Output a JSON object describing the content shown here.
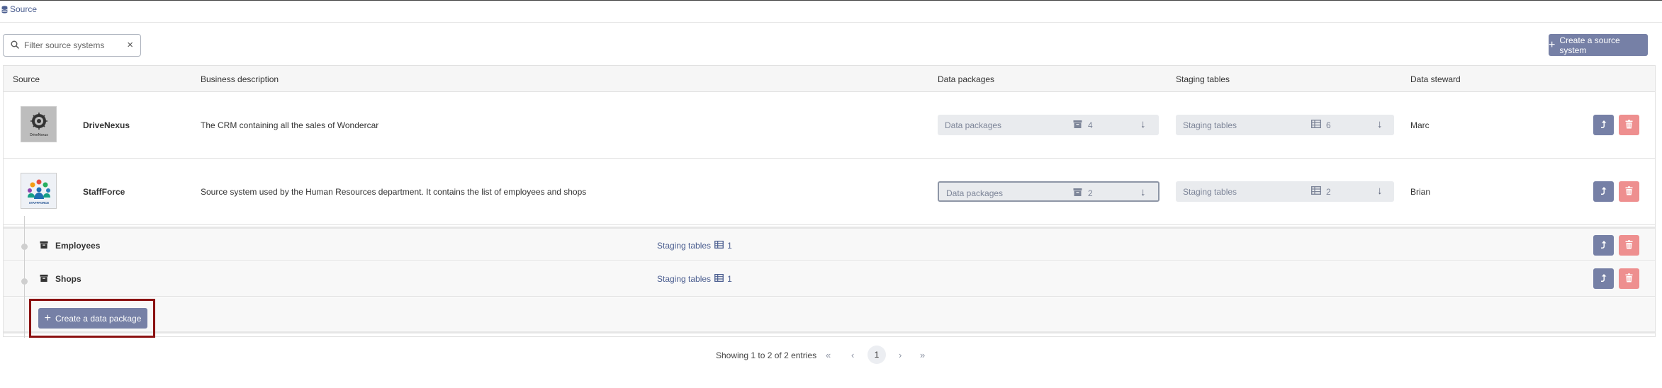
{
  "breadcrumb": {
    "label": "Source"
  },
  "search": {
    "placeholder": "Filter source systems",
    "value": "",
    "clear_icon": "×"
  },
  "toolbar": {
    "create_label": "Create a source system"
  },
  "table": {
    "headers": {
      "source": "Source",
      "description": "Business description",
      "packages": "Data packages",
      "staging": "Staging tables",
      "steward": "Data steward"
    },
    "rows": [
      {
        "name": "DriveNexus",
        "description": "The CRM containing all the sales of Wondercar",
        "packages_label": "Data packages",
        "packages_count": "4",
        "staging_label": "Staging tables",
        "staging_count": "6",
        "steward": "Marc",
        "logo_text": "DriveNexus"
      },
      {
        "name": "StaffForce",
        "description": "Source system used by the Human Resources department. It contains the list of employees and shops",
        "packages_label": "Data packages",
        "packages_count": "2",
        "staging_label": "Staging tables",
        "staging_count": "2",
        "steward": "Brian",
        "logo_text": "STAFFFORCE"
      }
    ],
    "packages": [
      {
        "name": "Employees",
        "staging_label": "Staging tables",
        "staging_count": "1"
      },
      {
        "name": "Shops",
        "staging_label": "Staging tables",
        "staging_count": "1"
      }
    ],
    "create_package_label": "Create a data package"
  },
  "pagination": {
    "summary": "Showing 1 to 2 of 2 entries",
    "first": "«",
    "prev": "‹",
    "current": "1",
    "next": "›",
    "last": "»"
  },
  "colors": {
    "primary_button": "#7680a6",
    "delete_button": "#ee8f8f",
    "highlight_border": "#8b1111",
    "link": "#4a5d8f"
  }
}
